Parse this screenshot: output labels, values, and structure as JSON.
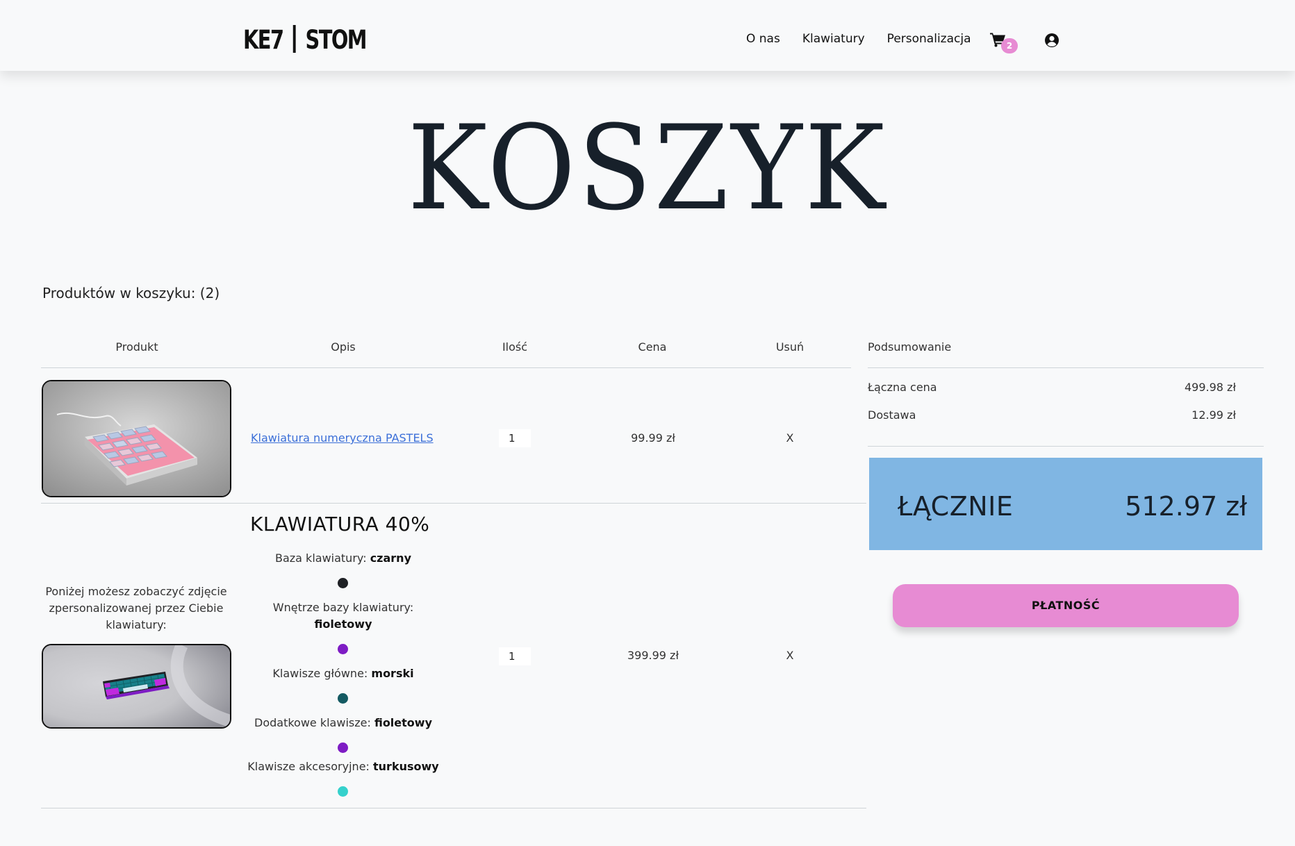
{
  "header": {
    "logo_left": "KE7",
    "logo_right": "STOM",
    "nav": [
      "O nas",
      "Klawiatury",
      "Personalizacja"
    ],
    "cart_count": "2"
  },
  "page_title": "KOSZYK",
  "cart_count_label": "Produktów w koszyku: (2)",
  "table": {
    "headers": [
      "Produkt",
      "Opis",
      "Ilość",
      "Cena",
      "Usuń"
    ]
  },
  "items": [
    {
      "link": "Klawiatura numeryczna PASTELS",
      "qty": "1",
      "price": "99.99 zł",
      "remove": "X"
    },
    {
      "title": "KLAWIATURA 40%",
      "intro": "Poniżej możesz zobaczyć zdjęcie zpersonalizowanej przez Ciebie klawiatury:",
      "specs": [
        {
          "label": "Baza klawiatury:",
          "value": "czarny",
          "color": "#1f2125"
        },
        {
          "label": "Wnętrze bazy klawiatury:",
          "value": "fioletowy",
          "color": "#7e1cc4"
        },
        {
          "label": "Klawisze główne:",
          "value": "morski",
          "color": "#145a62"
        },
        {
          "label": "Dodatkowe klawisze:",
          "value": "fioletowy",
          "color": "#7e1cc4"
        },
        {
          "label": "Klawisze akcesoryjne:",
          "value": "turkusowy",
          "color": "#35d1cc"
        }
      ],
      "qty": "1",
      "price": "399.99 zł",
      "remove": "X"
    }
  ],
  "summary": {
    "heading": "Podsumowanie",
    "rows": [
      {
        "label": "Łączna cena",
        "value": "499.98 zł"
      },
      {
        "label": "Dostawa",
        "value": "12.99 zł"
      }
    ],
    "total_label": "ŁĄCZNIE",
    "total_value": "512.97 zł",
    "pay_button": "PŁATNOŚĆ"
  },
  "colors": {
    "accent_pink": "#e78bd3",
    "total_box": "#80b6e3",
    "link": "#3b6fd8"
  }
}
